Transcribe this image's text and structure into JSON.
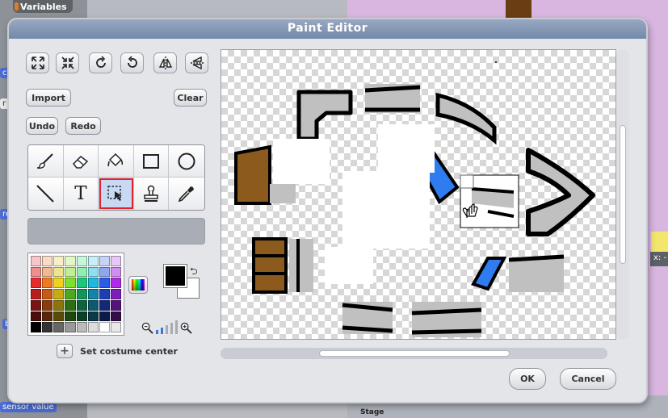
{
  "background": {
    "variables_tab": "Variables",
    "blocks": [
      "ch",
      "r na",
      "res",
      "b",
      "sensor value"
    ],
    "stage_readout": "x: -",
    "sprite_label": "Stage"
  },
  "dialog": {
    "title": "Paint Editor",
    "transform_tools": [
      {
        "name": "grow-icon"
      },
      {
        "name": "shrink-icon"
      },
      {
        "name": "rotate-right-icon"
      },
      {
        "name": "rotate-left-icon"
      },
      {
        "name": "flip-horizontal-icon"
      },
      {
        "name": "flip-vertical-icon"
      }
    ],
    "import_label": "Import",
    "clear_label": "Clear",
    "undo_label": "Undo",
    "redo_label": "Redo",
    "tools": [
      {
        "name": "paintbrush-icon",
        "selected": false
      },
      {
        "name": "eraser-icon",
        "selected": false
      },
      {
        "name": "fill-bucket-icon",
        "selected": false
      },
      {
        "name": "rectangle-icon",
        "selected": false
      },
      {
        "name": "ellipse-icon",
        "selected": false
      },
      {
        "name": "line-icon",
        "selected": false
      },
      {
        "name": "text-tool-icon",
        "selected": false
      },
      {
        "name": "select-icon",
        "selected": true
      },
      {
        "name": "stamp-icon",
        "selected": false
      },
      {
        "name": "eyedropper-icon",
        "selected": false
      }
    ],
    "text_tool_glyph": "T",
    "palette_colors": [
      "#f7c6c6",
      "#f7dcc6",
      "#f7f0c6",
      "#e1f7c6",
      "#c6f7d8",
      "#c6eff7",
      "#c6d3f7",
      "#e8c6f7",
      "#f08e8e",
      "#f0b98e",
      "#f0e38e",
      "#bff08e",
      "#8ef0b3",
      "#8ee0f0",
      "#8ea8f0",
      "#d08ef0",
      "#e82b2b",
      "#f07a1e",
      "#f0d21e",
      "#7ee02b",
      "#1ec87a",
      "#1eb8e0",
      "#2b5ee8",
      "#b02be8",
      "#b81e1e",
      "#c85a12",
      "#c8aa12",
      "#4ea81e",
      "#12965a",
      "#1284a8",
      "#1e3eb8",
      "#7e1eb8",
      "#7a1414",
      "#8a3c0c",
      "#8a760c",
      "#2e6e12",
      "#0c643c",
      "#0c5a70",
      "#14287a",
      "#52147a",
      "#4a0c0c",
      "#5a2808",
      "#5a4c08",
      "#1e480c",
      "#084028",
      "#083a48",
      "#0c1a4a",
      "#340c4a",
      "#000000",
      "#333333",
      "#666666",
      "#999999",
      "#bbbbbb",
      "#dddddd",
      "#ffffff",
      "#e8e8e8"
    ],
    "foreground_color": "#000000",
    "background_color": "#ffffff",
    "zoom_level": 2,
    "zoom_levels": 5,
    "set_center_symbol": "+",
    "set_center_label": "Set costume center",
    "ok_label": "OK",
    "cancel_label": "Cancel",
    "colors": {
      "title_bar": "#7f93b3",
      "selected_tool_outline": "#e0232b",
      "accent_blue": "#2f7cf0",
      "brown": "#8c5a1c",
      "gray_fill": "#c0c0c0"
    }
  }
}
